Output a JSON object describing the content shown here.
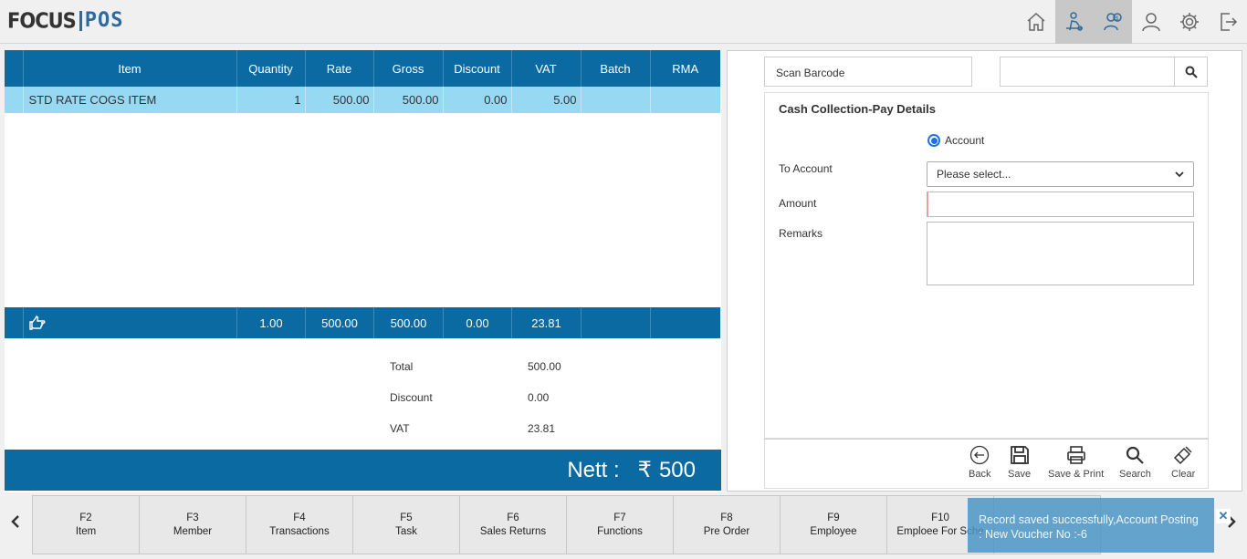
{
  "header": {
    "logo_focus": "FOCUS",
    "logo_pos": "POS",
    "icons": [
      "home-icon",
      "delivery-person-icon",
      "cash-collection-icon",
      "user-icon",
      "settings-icon",
      "logout-icon"
    ]
  },
  "grid": {
    "columns": [
      "Item",
      "Quantity",
      "Rate",
      "Gross",
      "Discount",
      "VAT",
      "Batch",
      "RMA"
    ],
    "rows": [
      {
        "item": "STD RATE COGS ITEM",
        "quantity": "1",
        "rate": "500.00",
        "gross": "500.00",
        "discount": "0.00",
        "vat": "5.00",
        "batch": "",
        "rma": ""
      }
    ],
    "totals": {
      "quantity": "1.00",
      "rate": "500.00",
      "gross": "500.00",
      "discount": "0.00",
      "vat": "23.81"
    }
  },
  "summary": {
    "total_label": "Total",
    "total_value": "500.00",
    "discount_label": "Discount",
    "discount_value": "0.00",
    "vat_label": "VAT",
    "vat_value": "23.81"
  },
  "nett": {
    "label": "Nett :",
    "currency": "₹",
    "value": "500"
  },
  "right": {
    "scan_barcode": "Scan Barcode",
    "search_value": "",
    "form_title": "Cash Collection-Pay Details",
    "radio_label": "Account",
    "to_account_label": "To Account",
    "to_account_value": "Please select...",
    "amount_label": "Amount",
    "amount_value": "",
    "remarks_label": "Remarks",
    "remarks_value": ""
  },
  "actions": [
    "Back",
    "Save",
    "Save & Print",
    "Search",
    "Clear"
  ],
  "fkeys": [
    {
      "key": "F2",
      "label": "Item"
    },
    {
      "key": "F3",
      "label": "Member"
    },
    {
      "key": "F4",
      "label": "Transactions"
    },
    {
      "key": "F5",
      "label": "Task"
    },
    {
      "key": "F6",
      "label": "Sales Returns"
    },
    {
      "key": "F7",
      "label": "Functions"
    },
    {
      "key": "F8",
      "label": "Pre Order"
    },
    {
      "key": "F9",
      "label": "Employee"
    },
    {
      "key": "F10",
      "label": "Emploee For Sche"
    },
    {
      "key": "",
      "label": ""
    }
  ],
  "toast": {
    "message": "Record saved successfully,Account Posting : New Voucher No :-6"
  }
}
